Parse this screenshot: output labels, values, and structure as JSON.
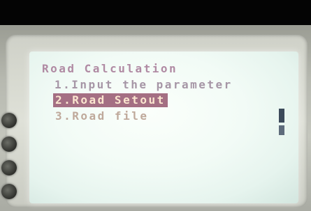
{
  "screen": {
    "title": "Road Calculation",
    "menu_items": [
      {
        "label": "1.Input the parameter",
        "selected": false
      },
      {
        "label": "2.Road Setout",
        "selected": true
      },
      {
        "label": "3.Road file",
        "selected": false
      }
    ]
  },
  "colors": {
    "highlight_background": "#a46f83",
    "highlight_text": "#fbe6cf",
    "screen_backlight": "#f2fbf6"
  },
  "icons": {
    "scrollbar": "scrollbar-icon"
  }
}
